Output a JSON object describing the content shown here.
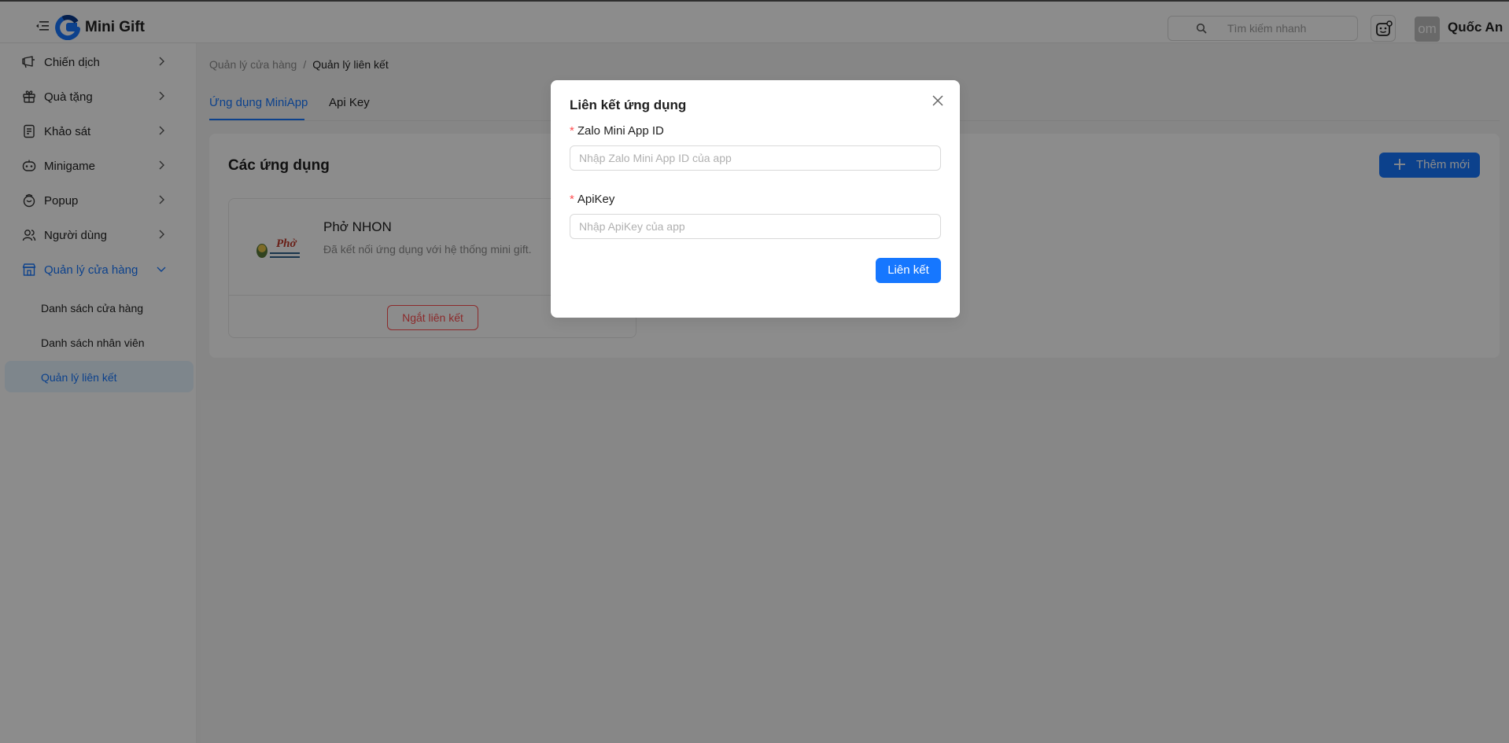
{
  "header": {
    "app_name": "Mini Gift",
    "search_placeholder": "Tìm kiếm nhanh",
    "user_initials": "om",
    "user_name": "Quốc An"
  },
  "sidebar": {
    "items": [
      {
        "label": "Chiến dịch",
        "icon": "campaign-icon"
      },
      {
        "label": "Quà tặng",
        "icon": "gift-icon"
      },
      {
        "label": "Khảo sát",
        "icon": "survey-icon"
      },
      {
        "label": "Minigame",
        "icon": "game-icon"
      },
      {
        "label": "Popup",
        "icon": "popup-icon"
      },
      {
        "label": "Người dùng",
        "icon": "users-icon"
      },
      {
        "label": "Quản lý cửa hàng",
        "icon": "store-icon",
        "expanded": true
      }
    ],
    "sub_items": [
      {
        "label": "Danh sách cửa hàng"
      },
      {
        "label": "Danh sách nhân viên"
      },
      {
        "label": "Quản lý liên kết",
        "active": true
      }
    ]
  },
  "breadcrumb": {
    "parent": "Quản lý cửa hàng",
    "separator": "/",
    "current": "Quản lý liên kết"
  },
  "tabs": [
    {
      "label": "Ứng dụng MiniApp",
      "active": true
    },
    {
      "label": "Api Key",
      "active": false
    }
  ],
  "main": {
    "title": "Các ứng dụng",
    "add_button": "Thêm mới",
    "app": {
      "logo_text": "Phở",
      "name": "Phở NHON",
      "description": "Đã kết nối ứng dụng với hệ thống mini gift.",
      "unlink_button": "Ngắt liên kết"
    }
  },
  "modal": {
    "title": "Liên kết ứng dụng",
    "required_mark": "*",
    "fields": [
      {
        "label": "Zalo Mini App ID",
        "placeholder": "Nhập Zalo Mini App ID của app",
        "value": ""
      },
      {
        "label": "ApiKey",
        "placeholder": "Nhập ApiKey của app",
        "value": ""
      }
    ],
    "submit_button": "Liên kết"
  },
  "colors": {
    "primary": "#1677ff",
    "danger": "#ff4d4f",
    "overlay": "rgba(0,0,0,0.45)"
  }
}
